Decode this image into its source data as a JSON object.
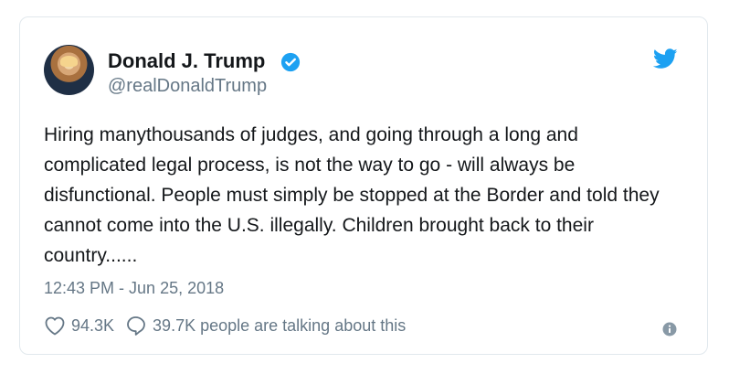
{
  "tweet": {
    "display_name": "Donald J. Trump",
    "handle": "@realDonaldTrump",
    "text": "Hiring manythousands of judges, and going through a long and complicated legal process, is not the way to go - will always be disfunctional. People must simply be stopped at the Border and told they cannot come into the U.S. illegally. Children brought back to their country......",
    "timestamp": "12:43 PM - Jun 25, 2018",
    "likes": "94.3K",
    "talking": "39.7K people are talking about this"
  },
  "icons": {
    "avatar": "profile-photo",
    "verified": "verified-badge-icon",
    "brand": "twitter-bird-icon",
    "like": "heart-icon",
    "reply": "speech-bubble-icon",
    "info": "info-icon"
  },
  "colors": {
    "brand_blue": "#1da1f2",
    "secondary_text": "#657786",
    "primary_text": "#14171a",
    "border": "#e1e8ed"
  }
}
